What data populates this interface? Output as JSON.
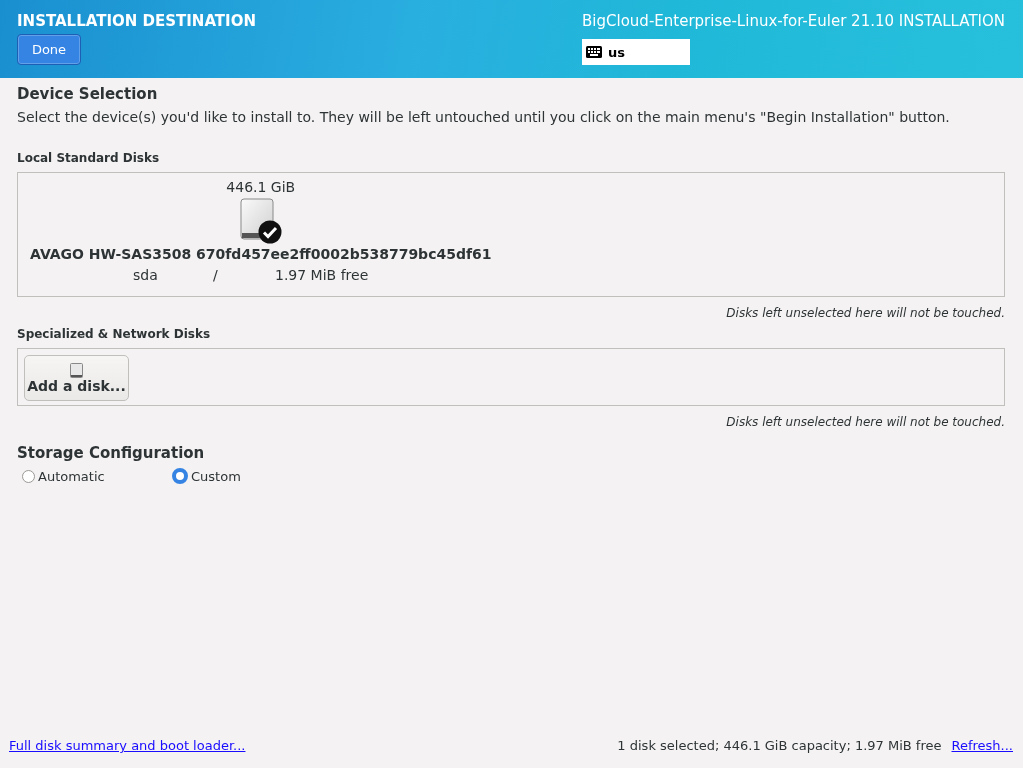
{
  "header": {
    "title": "INSTALLATION DESTINATION",
    "done_button": "Done",
    "product": "BigCloud-Enterprise-Linux-for-Euler 21.10 INSTALLATION",
    "keyboard_layout": "us"
  },
  "device_selection": {
    "title": "Device Selection",
    "description": "Select the device(s) you'd like to install to.  They will be left untouched until you click on the main menu's \"Begin Installation\" button."
  },
  "local_disks": {
    "title": "Local Standard Disks",
    "disks": [
      {
        "size": "446.1 GiB",
        "name": "AVAGO HW-SAS3508 670fd457ee2ff0002b538779bc45df61",
        "device": "sda",
        "mount": "/",
        "free": "1.97 MiB free",
        "selected": true
      }
    ],
    "note": "Disks left unselected here will not be touched."
  },
  "network_disks": {
    "title": "Specialized & Network Disks",
    "add_button": "Add a disk...",
    "note": "Disks left unselected here will not be touched."
  },
  "storage_configuration": {
    "title": "Storage Configuration",
    "options": [
      {
        "label": "Automatic",
        "selected": false
      },
      {
        "label": "Custom",
        "selected": true
      }
    ]
  },
  "footer": {
    "summary_link": "Full disk summary and boot loader...",
    "status": "1 disk selected; 446.1 GiB capacity; 1.97 MiB free",
    "refresh_link": "Refresh..."
  }
}
